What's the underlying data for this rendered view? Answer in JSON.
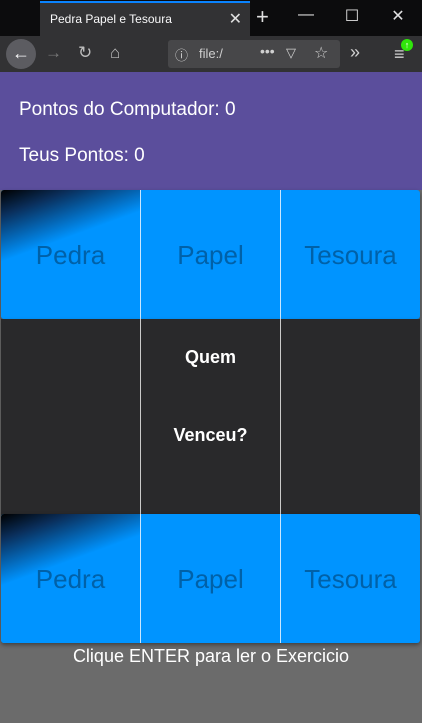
{
  "browser": {
    "tab_title": "Pedra Papel e Tesoura",
    "url": "file:/"
  },
  "score": {
    "computer_label": "Pontos do Computador: 0",
    "player_label": "Teus Pontos: 0"
  },
  "computer_choices": [
    "Pedra",
    "Papel",
    "Tesoura"
  ],
  "result": {
    "line1": "Quem",
    "line2": "Venceu?"
  },
  "player_choices": [
    "Pedra",
    "Papel",
    "Tesoura"
  ],
  "footer": {
    "instruction": "Clique ENTER para ler o Exercicio"
  },
  "colors": {
    "score_panel": "#5b4e9c",
    "choice_blue": "#0094ff",
    "choice_text": "#0061a8",
    "result_bg": "#29292b",
    "page_bg": "#6b6b6b"
  }
}
